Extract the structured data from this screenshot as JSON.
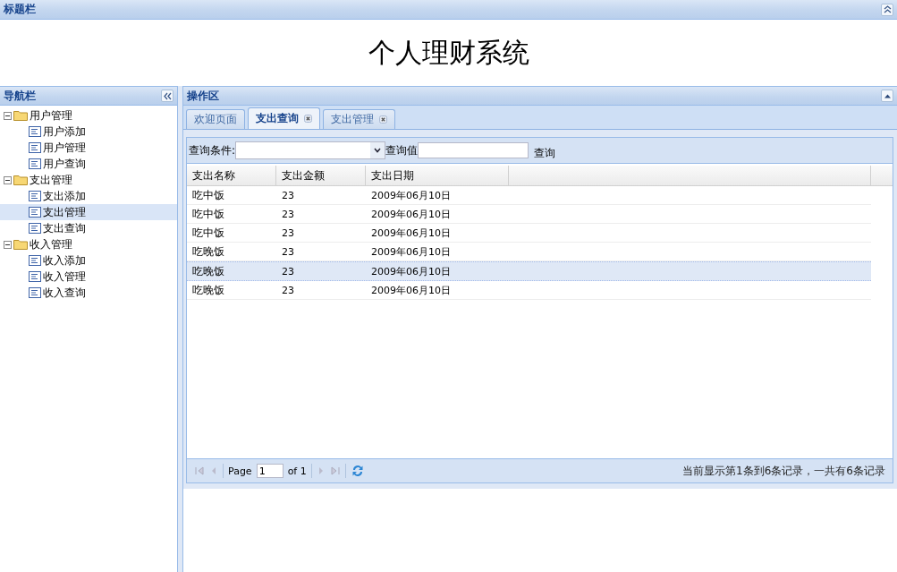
{
  "header_panel": {
    "title": "标题栏",
    "app_title": "个人理财系统"
  },
  "nav": {
    "title": "导航栏",
    "tree": [
      {
        "label": "用户管理",
        "expanded": true,
        "children": [
          {
            "label": "用户添加",
            "selected": false
          },
          {
            "label": "用户管理",
            "selected": false
          },
          {
            "label": "用户查询",
            "selected": false
          }
        ]
      },
      {
        "label": "支出管理",
        "expanded": true,
        "children": [
          {
            "label": "支出添加",
            "selected": false
          },
          {
            "label": "支出管理",
            "selected": true
          },
          {
            "label": "支出查询",
            "selected": false
          }
        ]
      },
      {
        "label": "收入管理",
        "expanded": true,
        "children": [
          {
            "label": "收入添加",
            "selected": false
          },
          {
            "label": "收入管理",
            "selected": false
          },
          {
            "label": "收入查询",
            "selected": false
          }
        ]
      }
    ]
  },
  "workspace": {
    "title": "操作区",
    "tabs": [
      {
        "label": "欢迎页面",
        "selected": false,
        "closable": false
      },
      {
        "label": "支出查询",
        "selected": true,
        "closable": true
      },
      {
        "label": "支出管理",
        "selected": false,
        "closable": true
      }
    ],
    "query": {
      "condition_label": "查询条件:",
      "value_label": "查询值",
      "search_button": "查询"
    },
    "grid": {
      "columns": [
        "支出名称",
        "支出金额",
        "支出日期"
      ],
      "rows": [
        {
          "cells": [
            "吃中饭",
            "23",
            "2009年06月10日"
          ],
          "selected": false
        },
        {
          "cells": [
            "吃中饭",
            "23",
            "2009年06月10日"
          ],
          "selected": false
        },
        {
          "cells": [
            "吃中饭",
            "23",
            "2009年06月10日"
          ],
          "selected": false
        },
        {
          "cells": [
            "吃晚饭",
            "23",
            "2009年06月10日"
          ],
          "selected": false
        },
        {
          "cells": [
            "吃晚饭",
            "23",
            "2009年06月10日"
          ],
          "selected": true
        },
        {
          "cells": [
            "吃晚饭",
            "23",
            "2009年06月10日"
          ],
          "selected": false
        }
      ]
    },
    "paging": {
      "page_label": "Page",
      "page": "1",
      "of_label": "of 1",
      "summary": "当前显示第1条到6条记录，一共有6条记录"
    }
  }
}
